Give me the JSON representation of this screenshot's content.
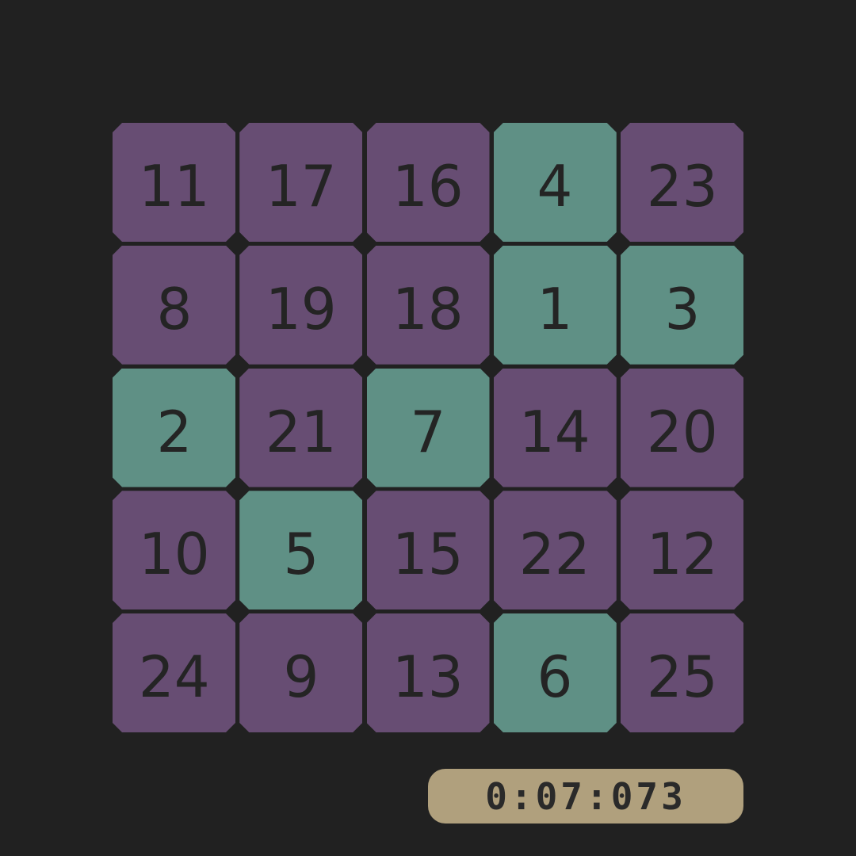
{
  "board": {
    "colors": {
      "unsolved": "#674d73",
      "solved": "#5f9085",
      "background": "#212121",
      "text": "#242424"
    },
    "tiles": [
      {
        "label": "11",
        "state": "unsolved"
      },
      {
        "label": "17",
        "state": "unsolved"
      },
      {
        "label": "16",
        "state": "unsolved"
      },
      {
        "label": "4",
        "state": "solved"
      },
      {
        "label": "23",
        "state": "unsolved"
      },
      {
        "label": "8",
        "state": "unsolved"
      },
      {
        "label": "19",
        "state": "unsolved"
      },
      {
        "label": "18",
        "state": "unsolved"
      },
      {
        "label": "1",
        "state": "solved"
      },
      {
        "label": "3",
        "state": "solved"
      },
      {
        "label": "2",
        "state": "solved"
      },
      {
        "label": "21",
        "state": "unsolved"
      },
      {
        "label": "7",
        "state": "solved"
      },
      {
        "label": "14",
        "state": "unsolved"
      },
      {
        "label": "20",
        "state": "unsolved"
      },
      {
        "label": "10",
        "state": "unsolved"
      },
      {
        "label": "5",
        "state": "solved"
      },
      {
        "label": "15",
        "state": "unsolved"
      },
      {
        "label": "22",
        "state": "unsolved"
      },
      {
        "label": "12",
        "state": "unsolved"
      },
      {
        "label": "24",
        "state": "unsolved"
      },
      {
        "label": "9",
        "state": "unsolved"
      },
      {
        "label": "13",
        "state": "unsolved"
      },
      {
        "label": "6",
        "state": "solved"
      },
      {
        "label": "25",
        "state": "unsolved"
      }
    ]
  },
  "timer": {
    "value": "0:07:073",
    "color": "#b0a07d"
  }
}
